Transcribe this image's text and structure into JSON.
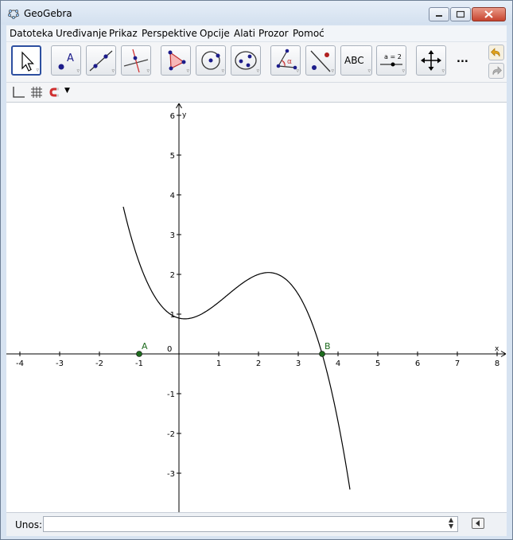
{
  "window": {
    "title": "GeoGebra"
  },
  "menu": [
    "Datoteka",
    "Uređivanje",
    "Prikaz",
    "Perspektive",
    "Opcije",
    "Alati",
    "Prozor",
    "Pomoć"
  ],
  "toolbar": {
    "tools": [
      "move",
      "point",
      "line",
      "perpendicular",
      "polygon",
      "circle",
      "conic",
      "angle",
      "reflect",
      "text",
      "slider",
      "move-graphics"
    ],
    "text_tool_label": "ABC",
    "slider_tool_label": "a = 2",
    "more_label": "..."
  },
  "graphics": {
    "x_axis_label": "x",
    "y_axis_label": "y",
    "origin_label": "0",
    "x_ticks": [
      "-4",
      "-3",
      "-2",
      "-1",
      "0",
      "1",
      "2",
      "3",
      "4",
      "5",
      "6",
      "7",
      "8"
    ],
    "y_ticks": [
      "6",
      "5",
      "4",
      "3",
      "2",
      "1",
      "-1",
      "-2",
      "-3"
    ],
    "points": [
      {
        "name": "A",
        "x": -1,
        "y": 0
      },
      {
        "name": "B",
        "x": 3.6,
        "y": 0
      }
    ],
    "point_color": "#1e6b1e",
    "curve_color": "#000000"
  },
  "input_bar": {
    "label": "Unos:",
    "value": ""
  }
}
